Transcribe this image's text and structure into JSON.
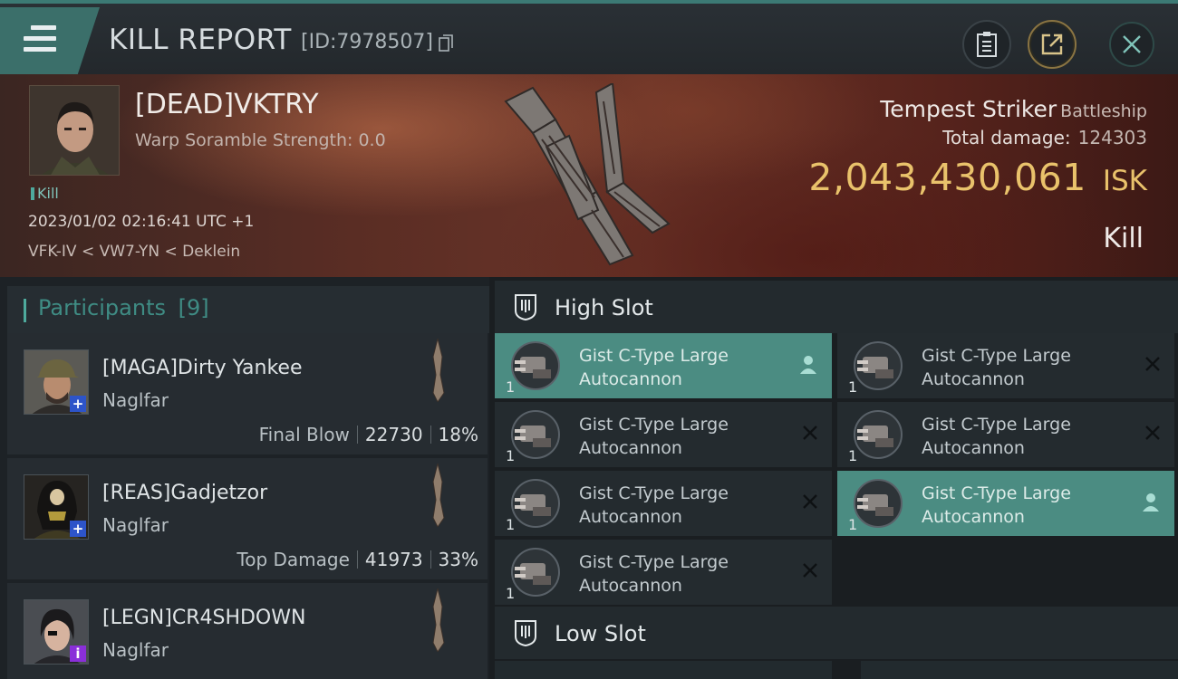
{
  "header": {
    "title": "KILL REPORT",
    "id_label": "[ID:7978507]"
  },
  "victim": {
    "name": "[DEAD]VKTRY",
    "scramble": "Warp Soramble Strength: 0.0",
    "tag": "Kill",
    "datetime": "2023/01/02 02:16:41 UTC +1",
    "location": "VFK-IV < VW7-YN < Deklein",
    "ship": "Tempest Striker",
    "ship_class": "Battleship",
    "total_damage_label": "Total damage:",
    "total_damage": "124303",
    "isk_value": "2,043,430,061",
    "isk_unit": "ISK",
    "result": "Kill"
  },
  "participants": {
    "title": "Participants",
    "count": "[9]",
    "items": [
      {
        "name": "[MAGA]Dirty Yankee",
        "ship": "Naglfar",
        "label": "Final Blow",
        "damage": "22730",
        "percent": "18%",
        "badge": "+"
      },
      {
        "name": "[REAS]Gadjetzor",
        "ship": "Naglfar",
        "label": "Top Damage",
        "damage": "41973",
        "percent": "33%",
        "badge": "+"
      },
      {
        "name": "[LEGN]CR4SHDOWN",
        "ship": "Naglfar",
        "label": "",
        "damage": "",
        "percent": "",
        "badge": "i"
      }
    ]
  },
  "fittings": {
    "high_slot_title": "High Slot",
    "low_slot_title": "Low Slot",
    "modules": [
      {
        "name": "Gist C-Type Large Autocannon",
        "qty": "1",
        "state": "active"
      },
      {
        "name": "Gist C-Type Large Autocannon",
        "qty": "1",
        "state": "destroyed"
      },
      {
        "name": "Gist C-Type Large Autocannon",
        "qty": "1",
        "state": "destroyed"
      },
      {
        "name": "Gist C-Type Large Autocannon",
        "qty": "1",
        "state": "destroyed"
      },
      {
        "name": "Gist C-Type Large Autocannon",
        "qty": "1",
        "state": "destroyed"
      },
      {
        "name": "Gist C-Type Large Autocannon",
        "qty": "1",
        "state": "active"
      },
      {
        "name": "Gist C-Type Large Autocannon",
        "qty": "1",
        "state": "destroyed"
      }
    ]
  },
  "colors": {
    "accent": "#4eaa9d",
    "active_row": "#4b8c82",
    "isk": "#e9c26b"
  }
}
